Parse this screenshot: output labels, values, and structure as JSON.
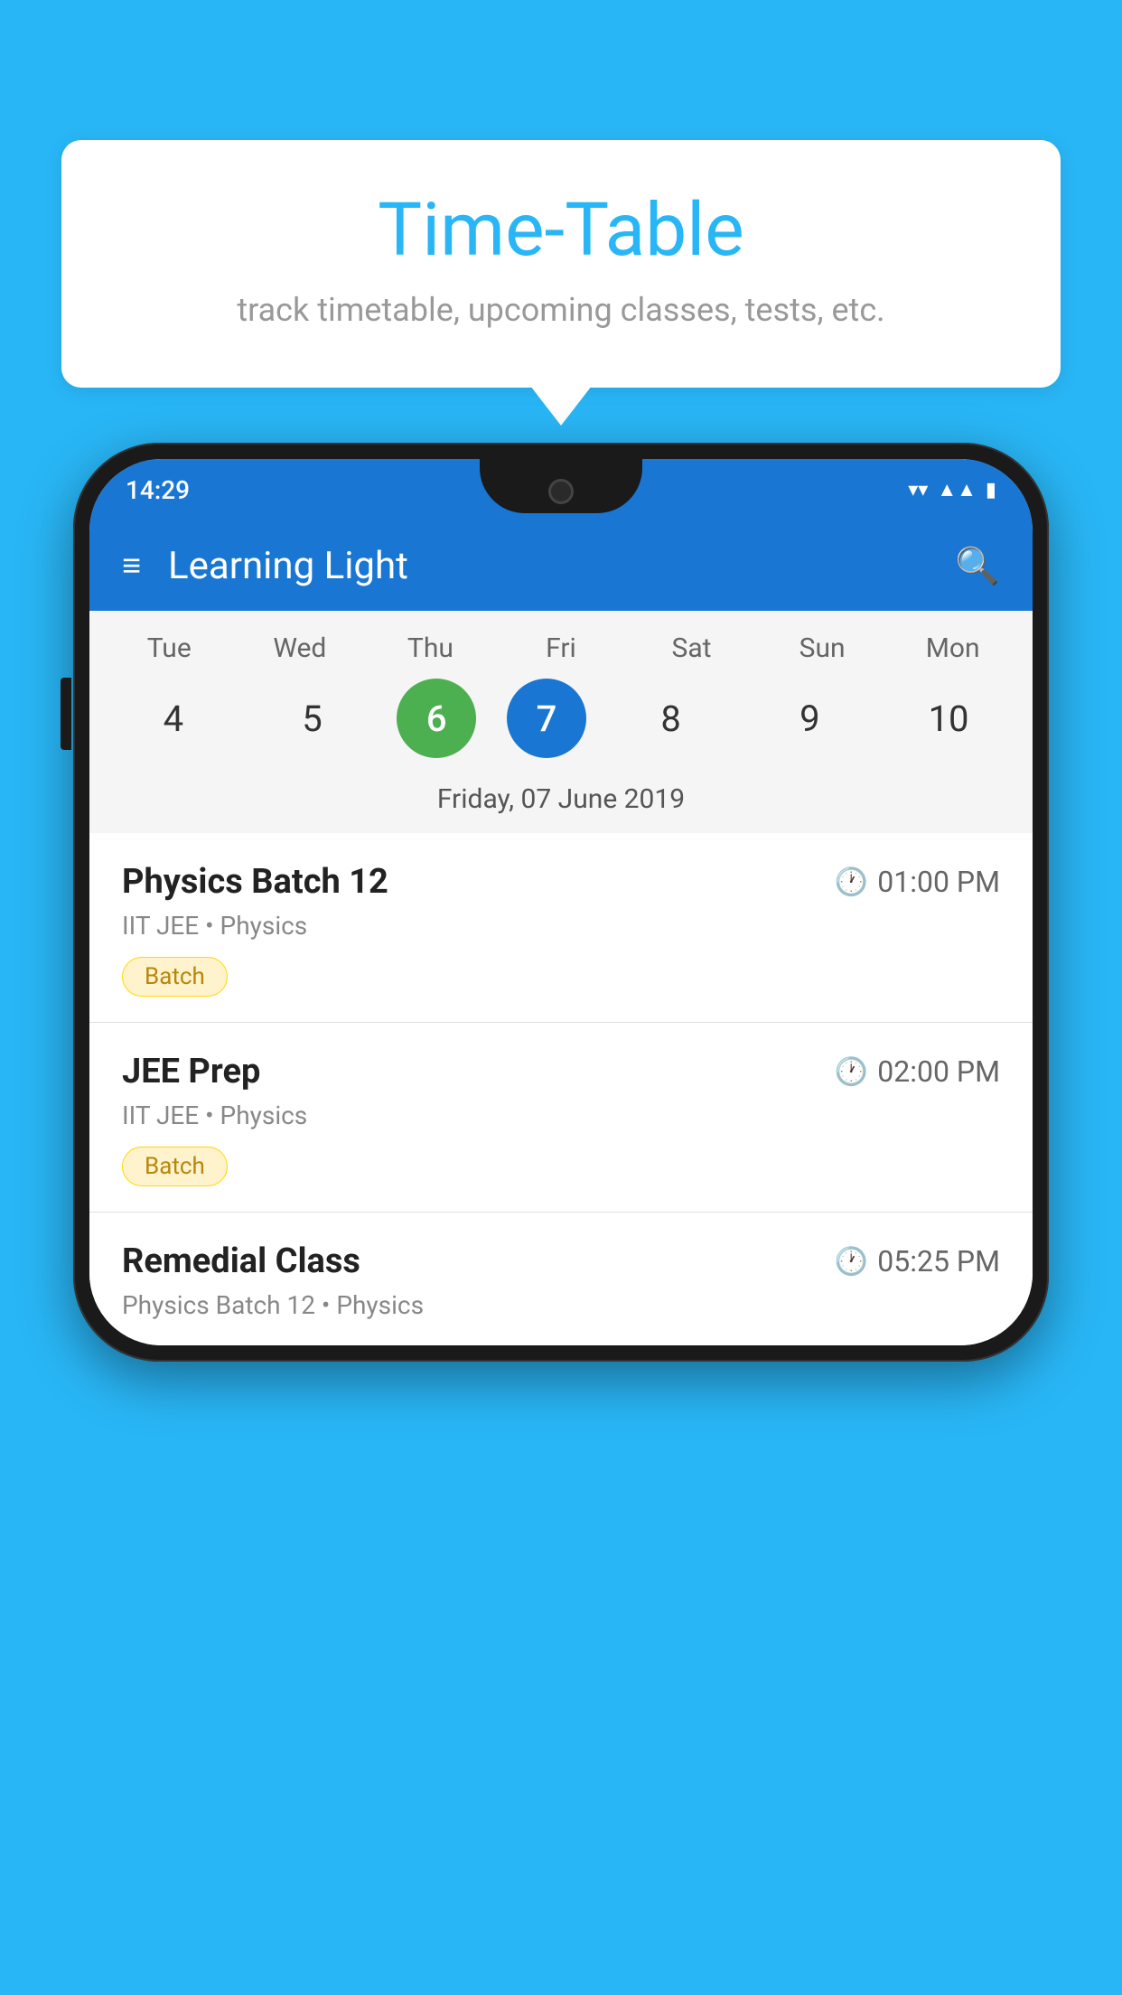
{
  "background_color": "#29B6F6",
  "bubble": {
    "title": "Time-Table",
    "subtitle": "track timetable, upcoming classes, tests, etc."
  },
  "phone": {
    "status_bar": {
      "time": "14:29",
      "icons": [
        "wifi",
        "signal",
        "battery"
      ]
    },
    "toolbar": {
      "title": "Learning Light"
    },
    "calendar": {
      "days": [
        {
          "label": "Tue",
          "number": "4"
        },
        {
          "label": "Wed",
          "number": "5"
        },
        {
          "label": "Thu",
          "number": "6",
          "state": "today"
        },
        {
          "label": "Fri",
          "number": "7",
          "state": "selected"
        },
        {
          "label": "Sat",
          "number": "8"
        },
        {
          "label": "Sun",
          "number": "9"
        },
        {
          "label": "Mon",
          "number": "10"
        }
      ],
      "selected_date": "Friday, 07 June 2019"
    },
    "classes": [
      {
        "name": "Physics Batch 12",
        "time": "01:00 PM",
        "meta": "IIT JEE • Physics",
        "badge": "Batch"
      },
      {
        "name": "JEE Prep",
        "time": "02:00 PM",
        "meta": "IIT JEE • Physics",
        "badge": "Batch"
      },
      {
        "name": "Remedial Class",
        "time": "05:25 PM",
        "meta": "Physics Batch 12 • Physics",
        "badge": null
      }
    ]
  }
}
